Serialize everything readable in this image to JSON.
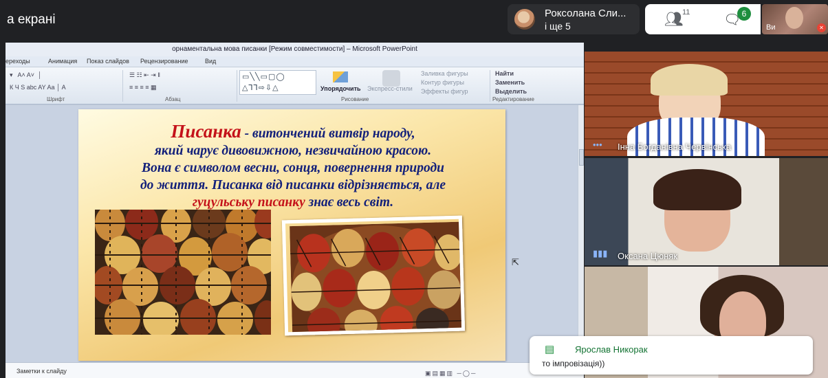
{
  "topbar": {
    "presenting_label": "а екрані",
    "presenter_name": "Роксолана Сли...",
    "presenter_more": "і ще 5",
    "people_count": "11",
    "chat_badge": "6",
    "self_label": "Ви"
  },
  "ppt": {
    "window_title": "орнаментальна мова писанки [Режим совместимости] – Microsoft PowerPoint",
    "tabs": [
      "ереходы",
      "Анимация",
      "Показ слайдов",
      "Рецензирование",
      "Вид"
    ],
    "groups": {
      "font": "Шрифт",
      "paragraph": "Абзац",
      "drawing": "Рисование",
      "editing": "Редактирование"
    },
    "tools": {
      "arrange": "Упорядочить",
      "quick_styles": "Экспресс-стили",
      "fill": "Заливка фигуры",
      "outline": "Контур фигуры",
      "effects": "Эффекты фигур",
      "find": "Найти",
      "replace": "Заменить",
      "select": "Выделить"
    },
    "notes_label": "Заметки к слайду"
  },
  "slide": {
    "title_word": "Писанка",
    "line1_rest": " - витончений витвір народу,",
    "line2": "який чарує дивовижною, незвичайною красою.",
    "line3": "Вона є символом весни, сонця, повернення природи",
    "line4": "до життя. Писанка від писанки відрізняється, але",
    "line5_red1": "гуцульську",
    "line5_red2": "писанку",
    "line5_rest": " знає весь світ."
  },
  "participants": [
    {
      "name": "Інна Богданівна Червінська"
    },
    {
      "name": "Оксана Цюняк"
    },
    {
      "name": ""
    }
  ],
  "chat_toast": {
    "sender": "Ярослав Никорак",
    "message": "то імпровізація))"
  },
  "colors": {
    "meet_bg": "#202124",
    "chat_green": "#1e8e3e",
    "slide_title_red": "#c4121a",
    "slide_text_blue": "#13207a"
  }
}
